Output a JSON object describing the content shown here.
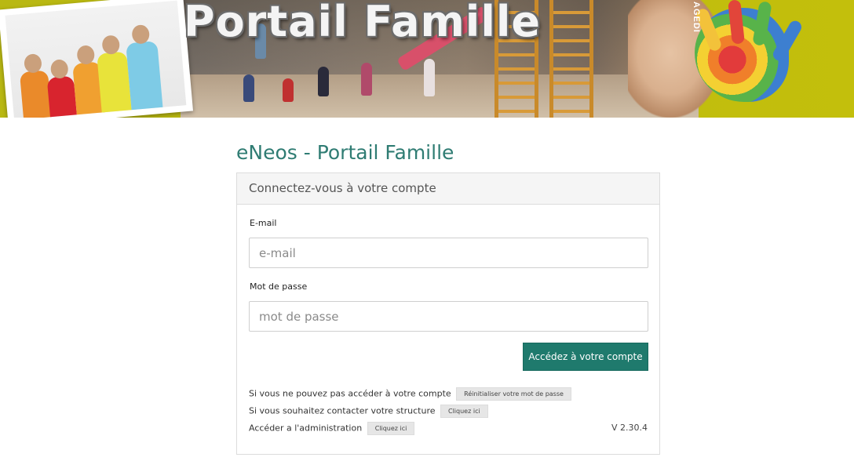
{
  "banner": {
    "title": "Portail Famille",
    "brand": "AGEDI"
  },
  "page": {
    "title": "eNeos - Portail Famille"
  },
  "login": {
    "heading": "Connectez-vous à votre compte",
    "email_label": "E-mail",
    "email_placeholder": "e-mail",
    "email_value": "",
    "password_label": "Mot de passe",
    "password_placeholder": "mot de passe",
    "password_value": "",
    "submit_label": "Accédez à votre compte"
  },
  "help": {
    "reset_text": "Si vous ne pouvez pas accéder à votre compte",
    "reset_button": "Réinitialiser votre mot de passe",
    "contact_text": "Si vous souhaitez contacter votre structure",
    "contact_button": "Cliquez ici",
    "admin_text": "Accéder a l'administration",
    "admin_button": "Cliquez ici"
  },
  "version": "V 2.30.4",
  "colors": {
    "accent": "#1f7a6d",
    "title": "#2f7c73",
    "banner_bg": "#c3bf0c"
  }
}
